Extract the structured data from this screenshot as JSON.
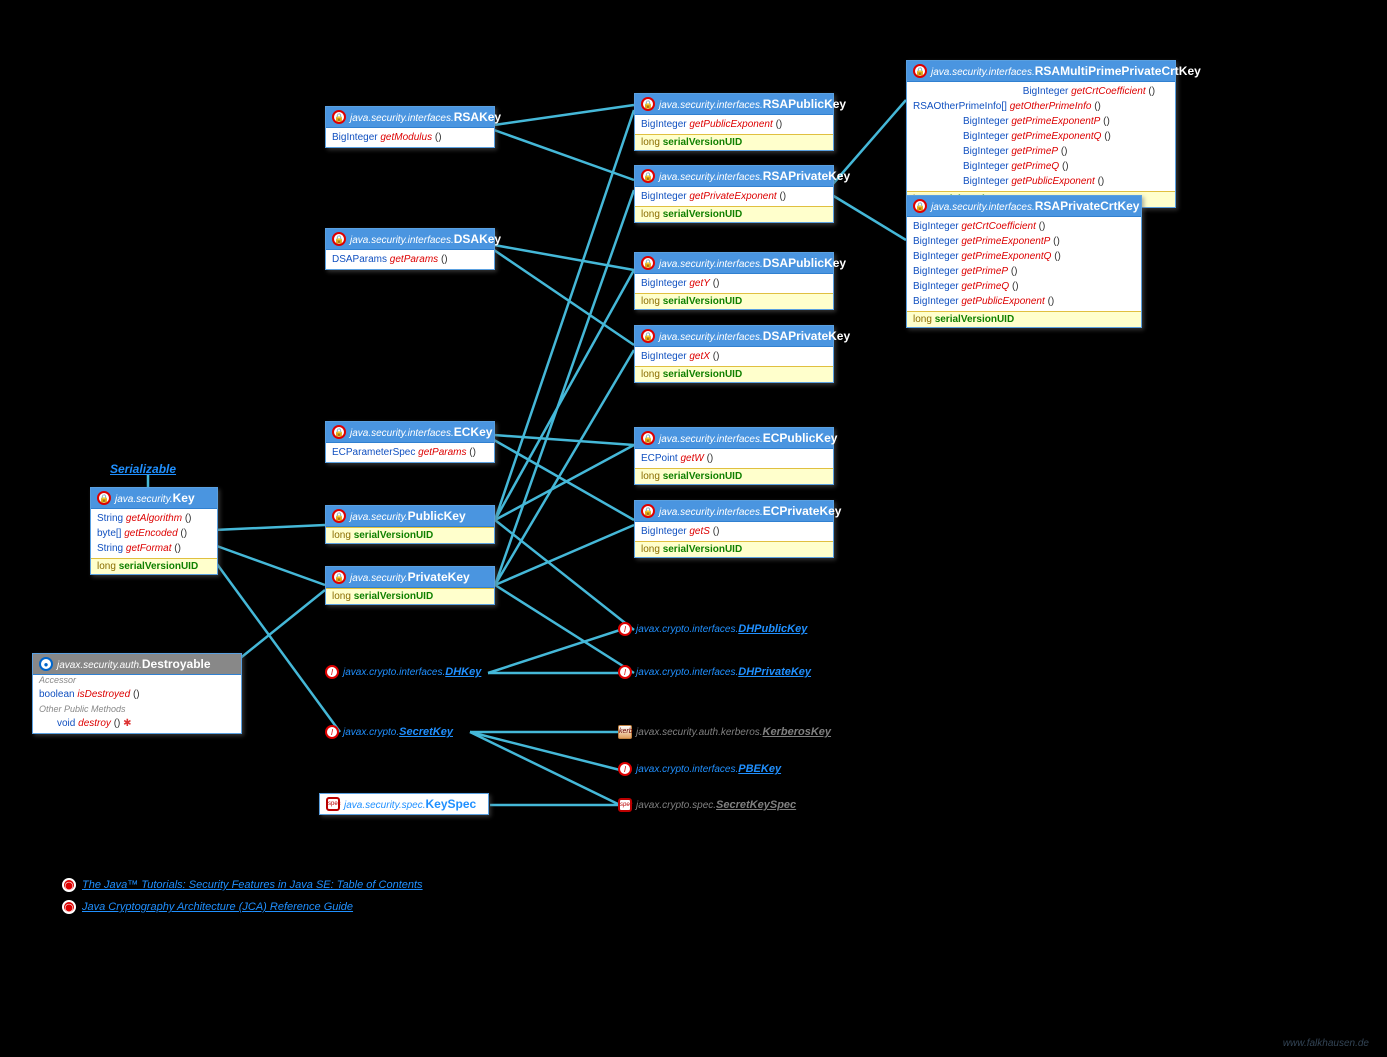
{
  "boxes": {
    "Key": {
      "pkg": "java.security.",
      "name": "Key",
      "rows": [
        {
          "type": "String",
          "method": "getAlgorithm"
        },
        {
          "type": "byte[]",
          "method": "getEncoded"
        },
        {
          "type": "String",
          "method": "getFormat"
        }
      ],
      "field": {
        "t": "long",
        "n": "serialVersionUID"
      }
    },
    "Destroyable": {
      "pkg": "javax.security.auth.",
      "name": "Destroyable",
      "accessors": [
        {
          "type": "boolean",
          "method": "isDestroyed"
        }
      ],
      "others": [
        {
          "type": "void",
          "method": "destroy",
          "suffix": " ✱"
        }
      ]
    },
    "RSAKey": {
      "pkg": "java.security.interfaces.",
      "name": "RSAKey",
      "rows": [
        {
          "type": "BigInteger",
          "method": "getModulus"
        }
      ]
    },
    "DSAKey": {
      "pkg": "java.security.interfaces.",
      "name": "DSAKey",
      "rows": [
        {
          "type": "DSAParams",
          "method": "getParams"
        }
      ]
    },
    "ECKey": {
      "pkg": "java.security.interfaces.",
      "name": "ECKey",
      "rows": [
        {
          "type": "ECParameterSpec",
          "method": "getParams"
        }
      ]
    },
    "PublicKey": {
      "pkg": "java.security.",
      "name": "PublicKey",
      "field": {
        "t": "long",
        "n": "serialVersionUID"
      }
    },
    "PrivateKey": {
      "pkg": "java.security.",
      "name": "PrivateKey",
      "field": {
        "t": "long",
        "n": "serialVersionUID"
      }
    },
    "RSAPublicKey": {
      "pkg": "java.security.interfaces.",
      "name": "RSAPublicKey",
      "rows": [
        {
          "type": "BigInteger",
          "method": "getPublicExponent"
        }
      ],
      "field": {
        "t": "long",
        "n": "serialVersionUID"
      }
    },
    "RSAPrivateKey": {
      "pkg": "java.security.interfaces.",
      "name": "RSAPrivateKey",
      "rows": [
        {
          "type": "BigInteger",
          "method": "getPrivateExponent"
        }
      ],
      "field": {
        "t": "long",
        "n": "serialVersionUID"
      }
    },
    "DSAPublicKey": {
      "pkg": "java.security.interfaces.",
      "name": "DSAPublicKey",
      "rows": [
        {
          "type": "BigInteger",
          "method": "getY"
        }
      ],
      "field": {
        "t": "long",
        "n": "serialVersionUID"
      }
    },
    "DSAPrivateKey": {
      "pkg": "java.security.interfaces.",
      "name": "DSAPrivateKey",
      "rows": [
        {
          "type": "BigInteger",
          "method": "getX"
        }
      ],
      "field": {
        "t": "long",
        "n": "serialVersionUID"
      }
    },
    "ECPublicKey": {
      "pkg": "java.security.interfaces.",
      "name": "ECPublicKey",
      "rows": [
        {
          "type": "ECPoint",
          "method": "getW"
        }
      ],
      "field": {
        "t": "long",
        "n": "serialVersionUID"
      }
    },
    "ECPrivateKey": {
      "pkg": "java.security.interfaces.",
      "name": "ECPrivateKey",
      "rows": [
        {
          "type": "BigInteger",
          "method": "getS"
        }
      ],
      "field": {
        "t": "long",
        "n": "serialVersionUID"
      }
    },
    "RSAMultiPrime": {
      "pkg": "java.security.interfaces.",
      "name": "RSAMultiPrimePrivateCrtKey",
      "rows": [
        {
          "type": "BigInteger",
          "method": "getCrtCoefficient"
        },
        {
          "type": "RSAOtherPrimeInfo[]",
          "method": "getOtherPrimeInfo"
        },
        {
          "type": "BigInteger",
          "method": "getPrimeExponentP"
        },
        {
          "type": "BigInteger",
          "method": "getPrimeExponentQ"
        },
        {
          "type": "BigInteger",
          "method": "getPrimeP"
        },
        {
          "type": "BigInteger",
          "method": "getPrimeQ"
        },
        {
          "type": "BigInteger",
          "method": "getPublicExponent"
        }
      ],
      "field": {
        "t": "long",
        "n": "serialVersionUID"
      }
    },
    "RSAPrivateCrt": {
      "pkg": "java.security.interfaces.",
      "name": "RSAPrivateCrtKey",
      "rows": [
        {
          "type": "BigInteger",
          "method": "getCrtCoefficient"
        },
        {
          "type": "BigInteger",
          "method": "getPrimeExponentP"
        },
        {
          "type": "BigInteger",
          "method": "getPrimeExponentQ"
        },
        {
          "type": "BigInteger",
          "method": "getPrimeP"
        },
        {
          "type": "BigInteger",
          "method": "getPrimeQ"
        },
        {
          "type": "BigInteger",
          "method": "getPublicExponent"
        }
      ],
      "field": {
        "t": "long",
        "n": "serialVersionUID"
      }
    },
    "KeySpec": {
      "pkg": "java.security.spec.",
      "name": "KeySpec"
    }
  },
  "minis": {
    "DHKey": {
      "pkg": "javax.crypto.interfaces.",
      "name": "DHKey"
    },
    "SecretKey": {
      "pkg": "javax.crypto.",
      "name": "SecretKey"
    },
    "DHPublicKey": {
      "pkg": "javax.crypto.interfaces.",
      "name": "DHPublicKey"
    },
    "DHPrivateKey": {
      "pkg": "javax.crypto.interfaces.",
      "name": "DHPrivateKey"
    },
    "KerberosKey": {
      "pkg": "javax.security.auth.kerberos.",
      "name": "KerberosKey"
    },
    "PBEKey": {
      "pkg": "javax.crypto.interfaces.",
      "name": "PBEKey"
    },
    "SecretKeySpec": {
      "pkg": "javax.crypto.spec.",
      "name": "SecretKeySpec"
    }
  },
  "labels": {
    "serializable": "Serializable"
  },
  "links": {
    "l1": "The Java™ Tutorials: Security Features in Java SE: Table of Contents",
    "l2": "Java Cryptography Architecture (JCA) Reference Guide"
  },
  "brand": "www.falkhausen.de",
  "lock_glyph": "🔒"
}
